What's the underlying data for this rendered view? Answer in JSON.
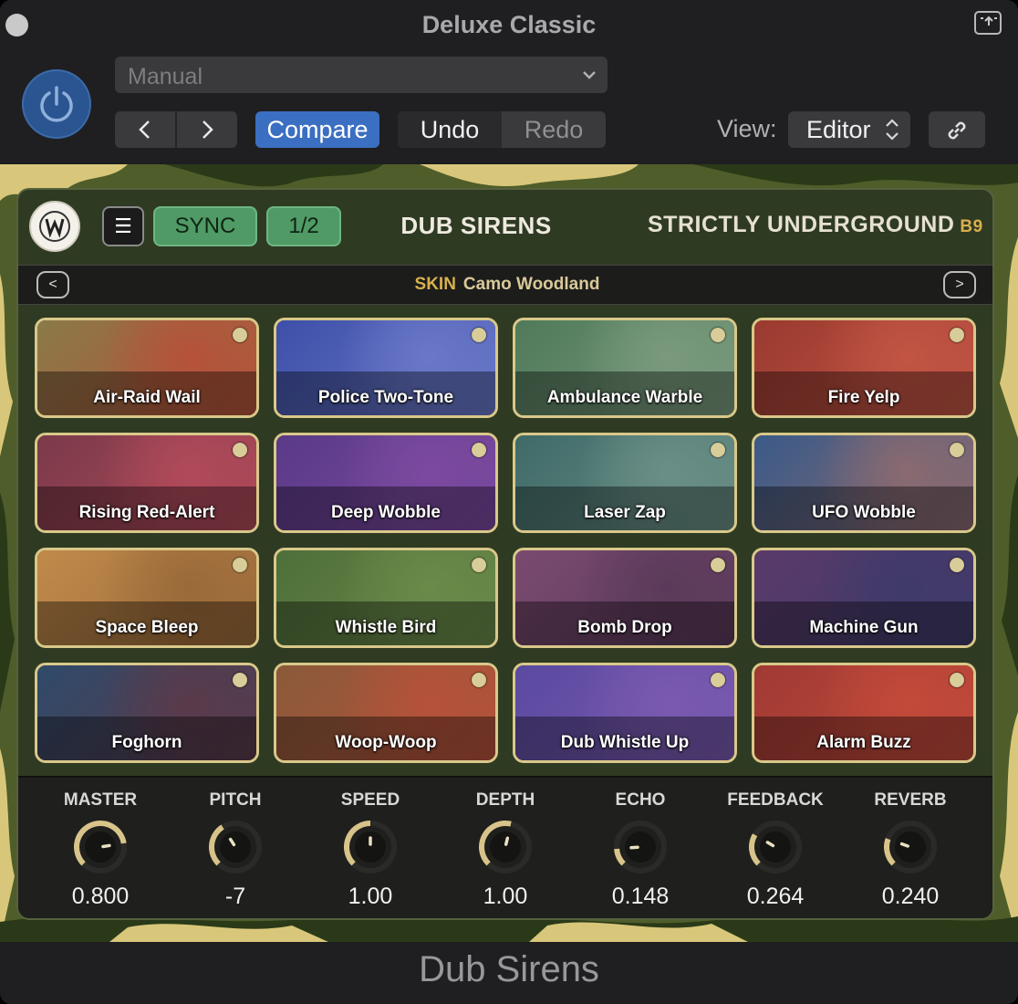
{
  "window": {
    "title": "Deluxe Classic",
    "footer_title": "Dub Sirens"
  },
  "host": {
    "preset_value": "Manual",
    "compare_label": "Compare",
    "undo_label": "Undo",
    "redo_label": "Redo",
    "view_label": "View:",
    "view_value": "Editor",
    "accent_color": "#3b6fc1",
    "icons": [
      "power-icon",
      "chevron-down-icon",
      "chevron-left-icon",
      "chevron-right-icon",
      "up-down-icon",
      "link-icon",
      "share-icon"
    ]
  },
  "plugin": {
    "menu_glyph": "☰",
    "sync_label": "SYNC",
    "rate_label": "1/2",
    "title": "DUB SIRENS",
    "brand": "STRICTLY UNDERGROUND",
    "brand_code": "B9",
    "skin_key": "SKIN",
    "skin_value": "Camo Woodland",
    "skin_prev": "<",
    "skin_next": ">",
    "pads": [
      {
        "label": "Air-Raid Wail",
        "c1": "#8a7a48",
        "c2": "#b5523a"
      },
      {
        "label": "Police Two-Tone",
        "c1": "#3d4fa8",
        "c2": "#6a78c8"
      },
      {
        "label": "Ambulance Warble",
        "c1": "#4f7a5a",
        "c2": "#7a9a7d"
      },
      {
        "label": "Fire Yelp",
        "c1": "#9a3a30",
        "c2": "#c25544"
      },
      {
        "label": "Rising Red-Alert",
        "c1": "#7a3a4a",
        "c2": "#b14a5a"
      },
      {
        "label": "Deep Wobble",
        "c1": "#5a3a88",
        "c2": "#7c4aa0"
      },
      {
        "label": "Laser Zap",
        "c1": "#3f6a68",
        "c2": "#6a8f86"
      },
      {
        "label": "UFO Wobble",
        "c1": "#3a5a88",
        "c2": "#8a6a70"
      },
      {
        "label": "Space Bleep",
        "c1": "#c08a4a",
        "c2": "#9a6a3a"
      },
      {
        "label": "Whistle Bird",
        "c1": "#4f6f3a",
        "c2": "#6a8a4a"
      },
      {
        "label": "Bomb Drop",
        "c1": "#7a4a70",
        "c2": "#5a3a5a"
      },
      {
        "label": "Machine Gun",
        "c1": "#5a3a6a",
        "c2": "#3f3a6a"
      },
      {
        "label": "Foghorn",
        "c1": "#2f4a6a",
        "c2": "#5a3a4a"
      },
      {
        "label": "Woop-Woop",
        "c1": "#8a5a3a",
        "c2": "#b5523a"
      },
      {
        "label": "Dub Whistle Up",
        "c1": "#5a4aa0",
        "c2": "#7a5ab0"
      },
      {
        "label": "Alarm Buzz",
        "c1": "#a03a34",
        "c2": "#c24a3a"
      }
    ],
    "knobs": [
      {
        "name": "MASTER",
        "value": "0.800",
        "level": 0.8
      },
      {
        "name": "PITCH",
        "value": "-7",
        "level": 0.38
      },
      {
        "name": "SPEED",
        "value": "1.00",
        "level": 0.5
      },
      {
        "name": "DEPTH",
        "value": "1.00",
        "level": 0.55
      },
      {
        "name": "ECHO",
        "value": "0.148",
        "level": 0.15
      },
      {
        "name": "FEEDBACK",
        "value": "0.264",
        "level": 0.28
      },
      {
        "name": "REVERB",
        "value": "0.240",
        "level": 0.24
      }
    ],
    "colors": {
      "pad_border": "#d9c88a",
      "sync_green": "#4f9a65",
      "knob_arc": "#d8c48a",
      "brand_gold": "#d8b04e"
    }
  }
}
